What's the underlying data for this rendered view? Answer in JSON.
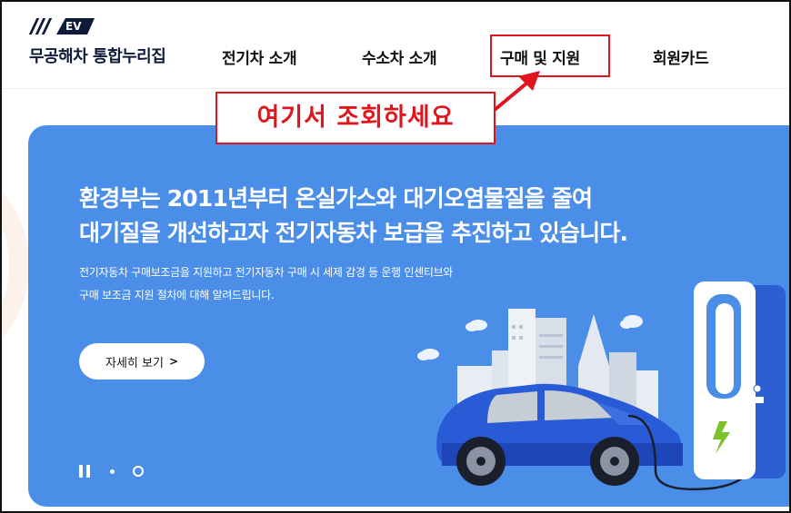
{
  "header": {
    "logo_badge": "EV",
    "logo_text": "무공해차 통합누리집",
    "nav": [
      {
        "label": "전기차 소개"
      },
      {
        "label": "수소차 소개"
      },
      {
        "label": "구매 및 지원"
      },
      {
        "label": "회원카드"
      }
    ]
  },
  "annotation": {
    "text": "여기서 조회하세요",
    "color": "#e0161f"
  },
  "hero": {
    "title_line1": "환경부는 2011년부터 온실가스와 대기오염물질을 줄여",
    "title_line2": "대기질을 개선하고자 전기자동차 보급을 추진하고 있습니다.",
    "desc_line1": "전기자동차 구매보조금을 지원하고 전기자동차 구매 시 세제 감경 등 운행 인센티브와",
    "desc_line2": "구매 보조금 지원 절차에 대해 알려드립니다.",
    "button_label": "자세히 보기",
    "background": "#4a8ee8"
  },
  "icons": {
    "detail_chevron": "chevron-right-icon",
    "pause": "pause-icon"
  }
}
